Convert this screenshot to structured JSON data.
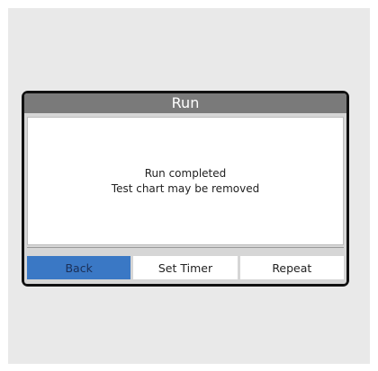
{
  "dialog": {
    "title": "Run",
    "message_line1": "Run completed",
    "message_line2": "Test chart may be removed"
  },
  "buttons": {
    "back": "Back",
    "set_timer": "Set Timer",
    "repeat": "Repeat"
  },
  "colors": {
    "backdrop": "#e9e9e9",
    "title_bar": "#7a7a7a",
    "primary_button": "#3a78c5"
  }
}
